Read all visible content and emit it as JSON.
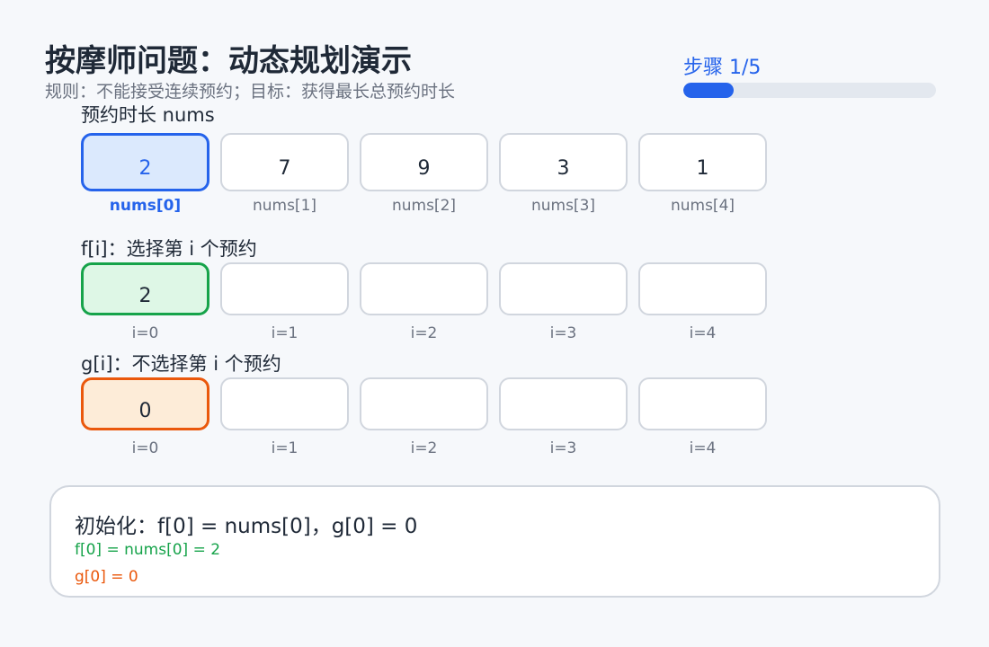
{
  "header": {
    "title": "按摩师问题：动态规划演示",
    "subtitle": "规则：不能接受连续预约；目标：获得最长总预约时长",
    "step_label": "步骤 1/5",
    "progress_fraction": 0.2
  },
  "nums_section": {
    "label": "预约时长 nums",
    "values": [
      "2",
      "7",
      "9",
      "3",
      "1"
    ],
    "indices": [
      "nums[0]",
      "nums[1]",
      "nums[2]",
      "nums[3]",
      "nums[4]"
    ]
  },
  "f_section": {
    "label": "f[i]：选择第 i 个预约",
    "values": [
      "2",
      "",
      "",
      "",
      ""
    ],
    "indices": [
      "i=0",
      "i=1",
      "i=2",
      "i=3",
      "i=4"
    ]
  },
  "g_section": {
    "label": "g[i]：不选择第 i 个预约",
    "values": [
      "0",
      "",
      "",
      "",
      ""
    ],
    "indices": [
      "i=0",
      "i=1",
      "i=2",
      "i=3",
      "i=4"
    ]
  },
  "note": {
    "main": "初始化：f[0] = nums[0]，g[0] = 0",
    "line_f": "f[0] = nums[0] = 2",
    "line_g": "g[0] = 0"
  },
  "colors": {
    "accent_blue": "#2563eb",
    "f_green": "#16a34a",
    "g_orange": "#ea580c"
  }
}
